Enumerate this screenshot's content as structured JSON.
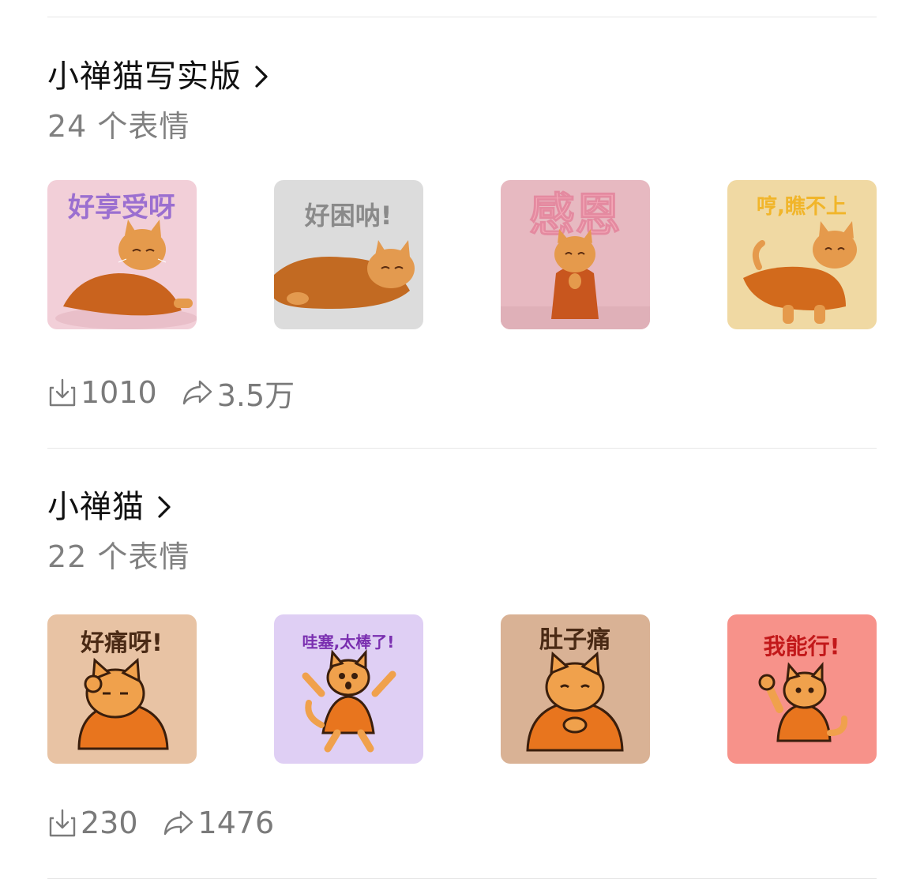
{
  "packs": [
    {
      "title": "小禅猫写实版",
      "count": "24 个表情",
      "downloads": "1010",
      "shares": "3.5万",
      "stickers": [
        {
          "caption": "好享受呀",
          "bg": "#f2cfd8",
          "caption_color": "#9b6fd0",
          "robe": "#c9631e"
        },
        {
          "caption": "好困呐!",
          "bg": "#dcdcdc",
          "caption_color": "#8a8a8a",
          "robe": "#c26a22"
        },
        {
          "caption": "感恩",
          "bg": "#e7b9c1",
          "caption_color": "#f3a6b6",
          "robe": "#c8561e"
        },
        {
          "caption": "哼,瞧不上",
          "bg": "#f0d9a3",
          "caption_color": "#f1b52a",
          "robe": "#d26a1c"
        }
      ]
    },
    {
      "title": "小禅猫",
      "count": "22 个表情",
      "downloads": "230",
      "shares": "1476",
      "stickers": [
        {
          "caption": "好痛呀!",
          "bg": "#e8c3a4",
          "caption_color": "#4a2a15",
          "robe": "#e8751e"
        },
        {
          "caption": "哇塞,太棒了!",
          "bg": "#dfcff4",
          "caption_color": "#7a2fb0",
          "robe": "#e8751e"
        },
        {
          "caption": "肚子痛",
          "bg": "#d9b295",
          "caption_color": "#4a2a15",
          "robe": "#e8751e"
        },
        {
          "caption": "我能行!",
          "bg": "#f7928a",
          "caption_color": "#c2181a",
          "robe": "#e8751e"
        }
      ]
    }
  ],
  "icons": {
    "chevron": "chevron-right-icon",
    "download": "download-icon",
    "share": "share-icon"
  }
}
